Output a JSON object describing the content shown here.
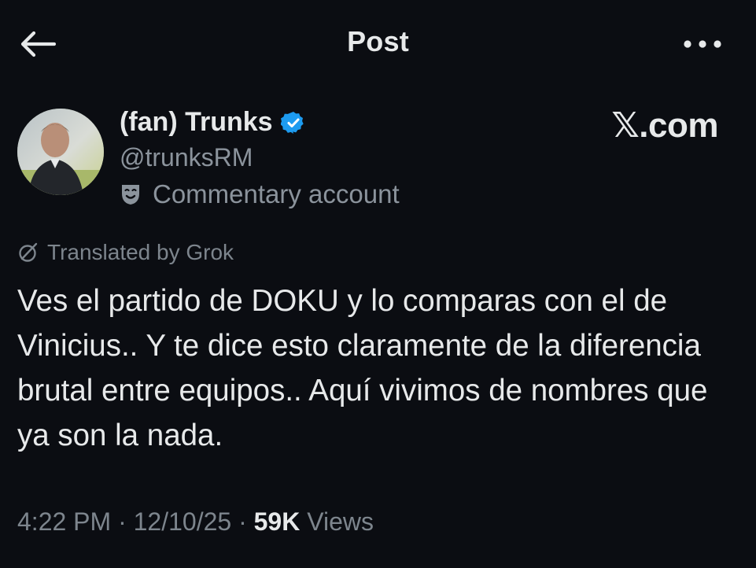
{
  "header": {
    "title": "Post",
    "back_icon": "arrow-left-icon",
    "more_icon": "more-horizontal-icon"
  },
  "author": {
    "display_name": "(fan) Trunks",
    "handle": "@trunksRM",
    "verified_icon": "verified-badge-icon",
    "verified_color": "#1d9bf0",
    "account_label_icon": "masks-icon",
    "account_label": "Commentary account"
  },
  "watermark": {
    "text": "𝕏.com"
  },
  "translation": {
    "icon": "grok-icon",
    "text": "Translated by Grok"
  },
  "post": {
    "text": "Ves el partido de DOKU y lo comparas con el de Vinicius.. Y te dice esto claramente de la diferencia brutal entre equipos.. Aquí vivimos de nombres que ya son la nada."
  },
  "meta": {
    "time": "4:22 PM",
    "date": "12/10/25",
    "separator": "·",
    "views_count": "59K",
    "views_label": "Views"
  },
  "colors": {
    "background": "#0b0d12",
    "primary_text": "#e7e9ea",
    "secondary_text": "#8b939c"
  }
}
